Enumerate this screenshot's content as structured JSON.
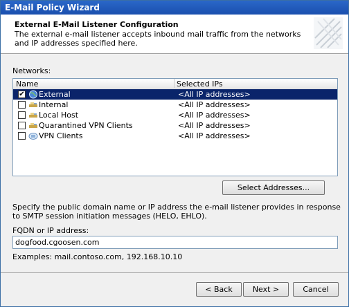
{
  "window": {
    "title": "E-Mail Policy Wizard"
  },
  "header": {
    "title": "External E-Mail Listener Configuration",
    "subtitle": "The external e-mail listener accepts inbound mail traffic from the networks and IP addresses specified here."
  },
  "networks": {
    "label": "Networks:",
    "columns": {
      "name": "Name",
      "ips": "Selected IPs"
    },
    "rows": [
      {
        "name": "External",
        "ips": "<All IP addresses>",
        "checked": true,
        "selected": true,
        "icon": "globe-icon"
      },
      {
        "name": "Internal",
        "ips": "<All IP addresses>",
        "checked": false,
        "selected": false,
        "icon": "network-icon"
      },
      {
        "name": "Local Host",
        "ips": "<All IP addresses>",
        "checked": false,
        "selected": false,
        "icon": "network-icon"
      },
      {
        "name": "Quarantined VPN Clients",
        "ips": "<All IP addresses>",
        "checked": false,
        "selected": false,
        "icon": "network-icon"
      },
      {
        "name": "VPN Clients",
        "ips": "<All IP addresses>",
        "checked": false,
        "selected": false,
        "icon": "vpn-clients-icon"
      }
    ]
  },
  "select_addresses_label": "Select Addresses...",
  "helo": {
    "text": "Specify the public domain name or IP address the e-mail listener provides in response to SMTP session initiation messages (HELO, EHLO).",
    "fqdn_label": "FQDN or IP address:",
    "fqdn_value": "dogfood.cgoosen.com",
    "examples": "Examples: mail.contoso.com, 192.168.10.10"
  },
  "buttons": {
    "back": "< Back",
    "next": "Next >",
    "cancel": "Cancel"
  },
  "colors": {
    "titlebar": "#1f5bbd",
    "selection": "#0a246a"
  }
}
